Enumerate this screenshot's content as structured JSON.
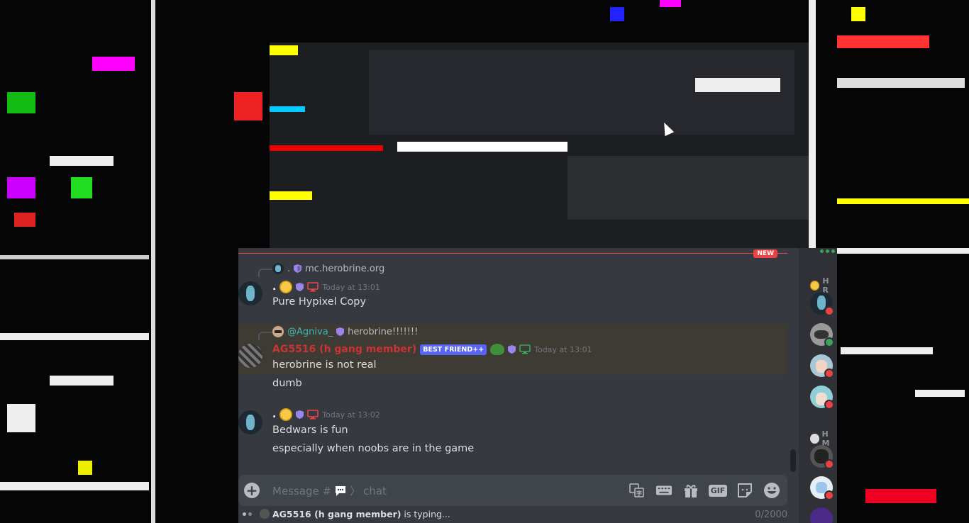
{
  "new_marker": "NEW",
  "messages": [
    {
      "reply": {
        "separator": ".",
        "text": "mc.herobrine.org"
      },
      "author": ".",
      "timestamp": "Today at 13:01",
      "lines": [
        "Pure Hypixel Copy"
      ]
    },
    {
      "reply": {
        "mention": "@Agniva_",
        "text": "herobrine!!!!!!!"
      },
      "author": "AG5516 (h gang member)",
      "badge": "BEST FRIEND++",
      "timestamp": "Today at 13:01",
      "lines": [
        "herobrine is not real",
        "dumb"
      ]
    },
    {
      "author": ".",
      "timestamp": "Today at 13:02",
      "lines": [
        "Bedwars is fun",
        "especially when noobs are in the game"
      ]
    }
  ],
  "input": {
    "placeholder_prefix": "Message #",
    "channel": "chat",
    "char_count": "0/2000",
    "icons": [
      "translate-icon",
      "keyboard-icon",
      "gift-icon",
      "gif-icon",
      "sticker-icon",
      "emoji-icon"
    ],
    "gif_label": "GIF"
  },
  "typing": {
    "user": "AG5516 (h gang member)",
    "suffix": " is typing..."
  },
  "members": {
    "group1": "H R",
    "group2": "H M"
  },
  "colors": {
    "bg_chat": "#36393f",
    "bg_members": "#2f3136",
    "accent_red": "#ed4245",
    "dnd": "#ed4245",
    "online": "#3ba55d",
    "badge": "#5865f2"
  }
}
